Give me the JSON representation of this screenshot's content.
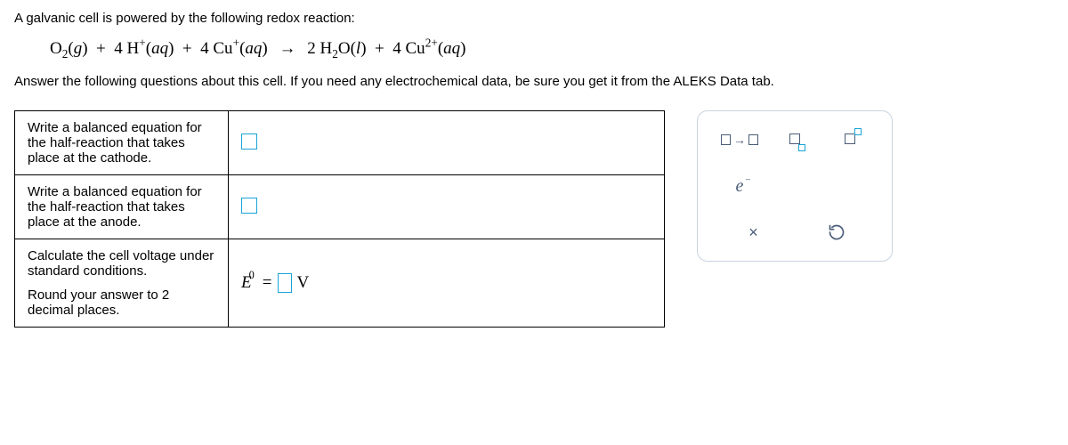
{
  "intro": "A galvanic cell is powered by the following redox reaction:",
  "equation": {
    "reactants": [
      {
        "base": "O",
        "sub": "2",
        "state": "(g)"
      },
      {
        "coef": "4",
        "base": "H",
        "sup": "+",
        "state": "(aq)"
      },
      {
        "coef": "4",
        "base": "Cu",
        "sup": "+",
        "state": "(aq)"
      }
    ],
    "products": [
      {
        "coef": "2",
        "base": "H",
        "sub": "2",
        "base2": "O",
        "state": "(l)"
      },
      {
        "coef": "4",
        "base": "Cu",
        "sup": "2+",
        "state": "(aq)"
      }
    ]
  },
  "instr_a": "Answer the following questions about this cell. If you need any electrochemical data, be sure you get it from the ",
  "instr_b": "ALEKS Data",
  "instr_c": " tab.",
  "rows": {
    "cathode": "Write a balanced equation for the half-reaction that takes place at the cathode.",
    "anode": "Write a balanced equation for the half-reaction that takes place at the anode.",
    "voltage_a": "Calculate the cell voltage under standard conditions.",
    "voltage_b": "Round your answer to 2 decimal places.",
    "evolt_unit": "V"
  },
  "toolbox": {
    "arrow": "→",
    "electron": "e",
    "clear": "×",
    "reset": "↺"
  }
}
